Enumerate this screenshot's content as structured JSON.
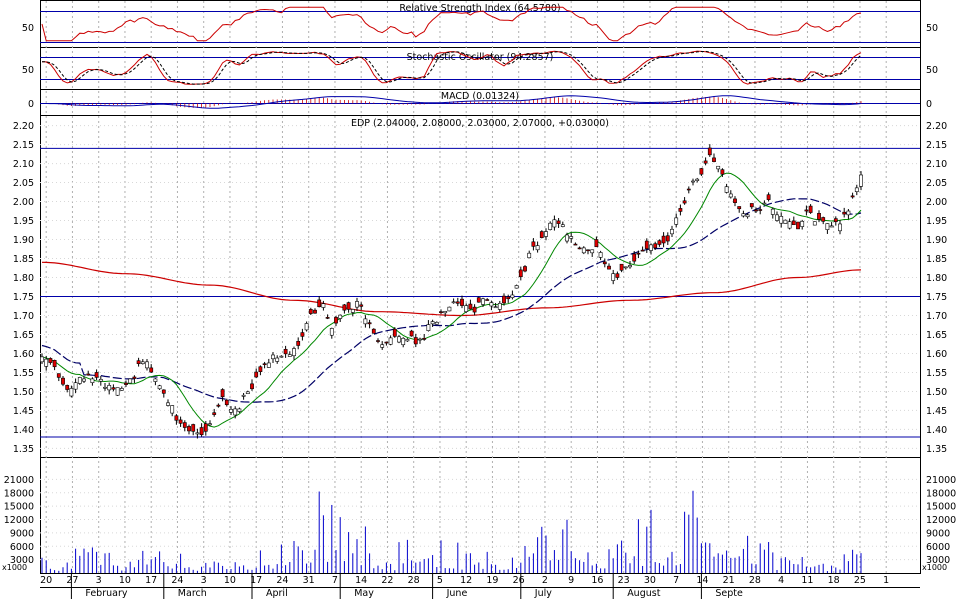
{
  "panels": {
    "rsi": {
      "title": "Relative Strength Index (64.5780)",
      "ticks": [
        "50"
      ],
      "line_color": "#cc0000",
      "guide_color": "#0000aa"
    },
    "stochastic": {
      "title": "Stochastic Oscillator (94.2857)",
      "ticks": [
        "50"
      ],
      "line_color": "#cc0000",
      "signal_color": "#000000",
      "guide_color": "#0000aa"
    },
    "macd": {
      "title": "MACD (0.01324)",
      "ticks": [
        "0"
      ],
      "hist_color": "#cc0000",
      "line_color": "#0000aa"
    },
    "volume": {
      "unit_label": "x1000",
      "bar_color": "#0000cc",
      "ticks": [
        "21000",
        "18000",
        "15000",
        "12000",
        "9000",
        "6000",
        "3000"
      ]
    }
  },
  "chart_data": {
    "type": "candlestick",
    "title": "EDP (2.04000, 2.08000, 2.03000, 2.07000, +0.03000)",
    "ylim": [
      1.33,
      2.22
    ],
    "y_ticks": [
      "2.20",
      "2.15",
      "2.10",
      "2.05",
      "2.00",
      "1.95",
      "1.90",
      "1.85",
      "1.80",
      "1.75",
      "1.70",
      "1.65",
      "1.60",
      "1.55",
      "1.50",
      "1.45",
      "1.40",
      "1.35"
    ],
    "horizontal_lines": [
      2.14,
      1.75,
      1.38
    ],
    "up_color": "#ffffff",
    "down_color": "#dd0000",
    "ma_colors": {
      "short": "#008800",
      "medium": "#000066",
      "long": "#cc0000"
    },
    "x_day_labels": [
      "20",
      "27",
      "3",
      "10",
      "17",
      "24",
      "3",
      "10",
      "17",
      "24",
      "31",
      "7",
      "14",
      "22",
      "28",
      "5",
      "12",
      "19",
      "26",
      "2",
      "9",
      "16",
      "23",
      "30",
      "7",
      "14",
      "21",
      "28",
      "4",
      "11",
      "18",
      "25",
      "1"
    ],
    "x_month_labels": [
      "February",
      "March",
      "April",
      "May",
      "June",
      "July",
      "August",
      "Septe"
    ],
    "anchors": [
      [
        0,
        1.6
      ],
      [
        3,
        1.56
      ],
      [
        6,
        1.5
      ],
      [
        9,
        1.53
      ],
      [
        12,
        1.54
      ],
      [
        15,
        1.52
      ],
      [
        18,
        1.51
      ],
      [
        21,
        1.53
      ],
      [
        24,
        1.58
      ],
      [
        27,
        1.54
      ],
      [
        30,
        1.47
      ],
      [
        33,
        1.41
      ],
      [
        36,
        1.39
      ],
      [
        38,
        1.38
      ],
      [
        40,
        1.42
      ],
      [
        43,
        1.48
      ],
      [
        46,
        1.45
      ],
      [
        49,
        1.5
      ],
      [
        52,
        1.56
      ],
      [
        55,
        1.59
      ],
      [
        58,
        1.6
      ],
      [
        61,
        1.62
      ],
      [
        64,
        1.7
      ],
      [
        67,
        1.73
      ],
      [
        69,
        1.67
      ],
      [
        72,
        1.71
      ],
      [
        75,
        1.73
      ],
      [
        78,
        1.67
      ],
      [
        81,
        1.63
      ],
      [
        84,
        1.64
      ],
      [
        87,
        1.64
      ],
      [
        90,
        1.63
      ],
      [
        93,
        1.68
      ],
      [
        96,
        1.72
      ],
      [
        99,
        1.74
      ],
      [
        102,
        1.71
      ],
      [
        105,
        1.74
      ],
      [
        108,
        1.73
      ],
      [
        111,
        1.74
      ],
      [
        114,
        1.8
      ],
      [
        117,
        1.88
      ],
      [
        120,
        1.92
      ],
      [
        122,
        1.96
      ],
      [
        124,
        1.94
      ],
      [
        126,
        1.9
      ],
      [
        129,
        1.88
      ],
      [
        132,
        1.88
      ],
      [
        135,
        1.82
      ],
      [
        137,
        1.8
      ],
      [
        140,
        1.84
      ],
      [
        143,
        1.87
      ],
      [
        146,
        1.88
      ],
      [
        149,
        1.9
      ],
      [
        152,
        1.98
      ],
      [
        155,
        2.05
      ],
      [
        157,
        2.08
      ],
      [
        159,
        2.12
      ],
      [
        161,
        2.1
      ],
      [
        163,
        2.04
      ],
      [
        165,
        2.0
      ],
      [
        167,
        1.97
      ],
      [
        170,
        1.98
      ],
      [
        173,
        2.0
      ],
      [
        175,
        1.97
      ],
      [
        178,
        1.95
      ],
      [
        180,
        1.92
      ],
      [
        182,
        1.97
      ],
      [
        185,
        1.95
      ],
      [
        188,
        1.94
      ],
      [
        190,
        1.95
      ],
      [
        192,
        1.98
      ],
      [
        194,
        2.03
      ],
      [
        195,
        2.07
      ]
    ],
    "volume_anchors": [
      [
        0,
        4000
      ],
      [
        10,
        5500
      ],
      [
        20,
        3500
      ],
      [
        30,
        8500
      ],
      [
        36,
        3000
      ],
      [
        45,
        4500
      ],
      [
        55,
        5000
      ],
      [
        62,
        9500
      ],
      [
        66,
        20000
      ],
      [
        70,
        16000
      ],
      [
        75,
        12000
      ],
      [
        80,
        6000
      ],
      [
        90,
        8000
      ],
      [
        100,
        6500
      ],
      [
        110,
        5500
      ],
      [
        118,
        12000
      ],
      [
        124,
        11000
      ],
      [
        132,
        7500
      ],
      [
        140,
        15000
      ],
      [
        146,
        19500
      ],
      [
        152,
        13000
      ],
      [
        157,
        21500
      ],
      [
        163,
        11000
      ],
      [
        170,
        8500
      ],
      [
        178,
        5500
      ],
      [
        185,
        5000
      ],
      [
        190,
        4000
      ],
      [
        195,
        5500
      ]
    ]
  }
}
